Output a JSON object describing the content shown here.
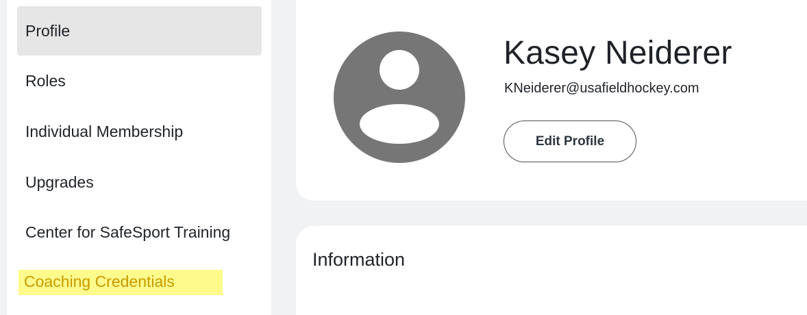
{
  "sidebar": {
    "items": [
      {
        "label": "Profile",
        "active": true
      },
      {
        "label": "Roles"
      },
      {
        "label": "Individual Membership"
      },
      {
        "label": "Upgrades"
      },
      {
        "label": "Center for SafeSport Training"
      },
      {
        "label": "Coaching Credentials",
        "highlighted": true
      }
    ]
  },
  "profile": {
    "avatar_icon": "user-avatar-placeholder",
    "name": "Kasey Neiderer",
    "email": "KNeiderer@usafieldhockey.com",
    "edit_button_label": "Edit Profile"
  },
  "information": {
    "title": "Information"
  },
  "colors": {
    "page_background": "#f1f2f4",
    "active_item_background": "#e6e6e6",
    "highlight_background": "#fffa8c",
    "highlight_text": "#c79a00",
    "avatar_gray": "#767676"
  }
}
